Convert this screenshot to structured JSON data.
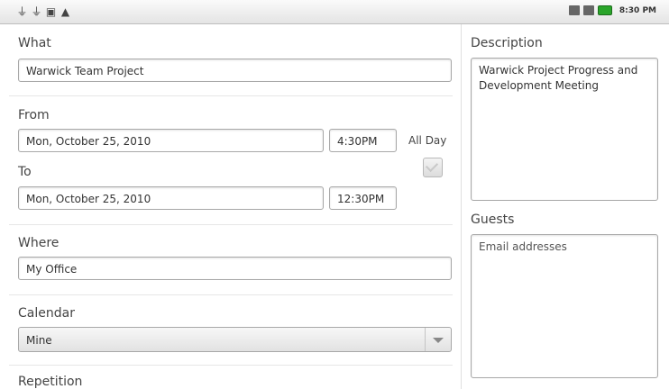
{
  "statusbar": {
    "left_icons": [
      "usb-icon",
      "usb-icon",
      "sd-card-icon",
      "warning-icon"
    ],
    "right_icons": [
      "sync-icon",
      "signal-icon",
      "battery-icon"
    ],
    "time": "8:30 PM"
  },
  "form": {
    "what_label": "What",
    "what_value": "Warwick Team Project",
    "from_label": "From",
    "from_date": "Mon, October 25, 2010",
    "from_time": "4:30PM",
    "all_day_label": "All Day",
    "all_day_checked": true,
    "to_label": "To",
    "to_date": "Mon, October 25, 2010",
    "to_time": "12:30PM",
    "where_label": "Where",
    "where_value": "My Office",
    "calendar_label": "Calendar",
    "calendar_value": "Mine",
    "repetition_label": "Repetition"
  },
  "sidepanel": {
    "description_label": "Description",
    "description_value": "Warwick Project Progress and Development Meeting",
    "guests_label": "Guests",
    "guests_placeholder": "Email addresses"
  },
  "colors": {
    "battery": "#2aa52a",
    "statusbar": "#eeeeee"
  }
}
